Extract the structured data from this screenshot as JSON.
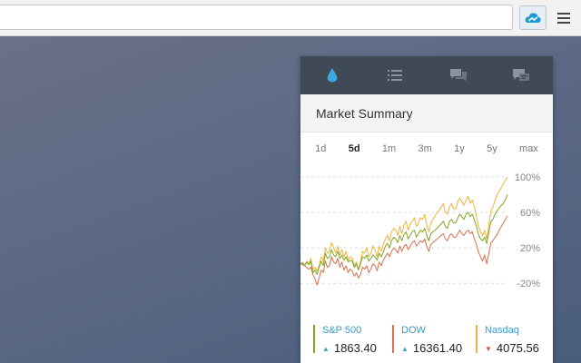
{
  "browser": {
    "url_value": "",
    "extension_icon": "cloud-sync-icon",
    "menu_icon": "hamburger-menu-icon"
  },
  "popup": {
    "tabs": [
      {
        "icon": "drop-icon",
        "active": true
      },
      {
        "icon": "list-icon",
        "active": false
      },
      {
        "icon": "chat-bubbles-icon",
        "active": false
      },
      {
        "icon": "chat-window-icon",
        "active": false
      }
    ],
    "section_title": "Market Summary",
    "ranges": [
      "1d",
      "5d",
      "1m",
      "3m",
      "1y",
      "5y",
      "max"
    ],
    "active_range": "5d",
    "colors": {
      "tab_bg": "#404a56",
      "active_tab_icon": "#3ba9e0",
      "inactive_tab_icon": "#8a939e",
      "sp500": "#7ea51f",
      "dow": "#d9704b",
      "nasdaq": "#f0b23e",
      "up": "#3aa8b3",
      "down": "#d9563a"
    }
  },
  "chart_data": {
    "type": "line",
    "x": [
      0,
      1,
      2,
      3,
      4,
      5,
      6,
      7,
      8,
      9,
      10,
      11,
      12,
      13,
      14,
      15,
      16,
      17,
      18,
      19,
      20,
      21,
      22,
      23,
      24,
      25,
      26,
      27,
      28,
      29,
      30,
      31,
      32,
      33,
      34,
      35,
      36,
      37,
      38,
      39,
      40,
      41,
      42,
      43,
      44,
      45,
      46,
      47,
      48,
      49,
      50,
      51,
      52,
      53,
      54,
      55,
      56,
      57,
      58,
      59,
      60,
      61,
      62,
      63,
      64,
      65,
      66,
      67,
      68,
      69,
      70,
      71,
      72,
      73,
      74,
      75,
      76,
      77,
      78,
      79,
      80,
      81,
      82,
      83,
      84,
      85,
      86,
      87,
      88,
      89,
      90,
      91,
      92,
      93,
      94,
      95,
      96,
      97,
      98,
      99,
      100
    ],
    "yticks": [
      "100%",
      "60%",
      "20%",
      "-20%"
    ],
    "ylim": [
      -30,
      105
    ],
    "series": [
      {
        "name": "S&P 500",
        "values": [
          2,
          3,
          0,
          4,
          1,
          5,
          -8,
          -5,
          -10,
          -2,
          5,
          0,
          14,
          8,
          10,
          18,
          12,
          10,
          16,
          8,
          12,
          6,
          10,
          4,
          6,
          5,
          -2,
          2,
          -5,
          2,
          10,
          8,
          12,
          5,
          8,
          12,
          10,
          6,
          14,
          10,
          15,
          22,
          25,
          20,
          28,
          32,
          30,
          26,
          34,
          28,
          35,
          38,
          30,
          34,
          38,
          40,
          32,
          36,
          40,
          38,
          42,
          34,
          28,
          36,
          38,
          40,
          42,
          45,
          47,
          50,
          44,
          42,
          50,
          52,
          48,
          48,
          54,
          58,
          55,
          52,
          58,
          60,
          55,
          58,
          52,
          44,
          35,
          30,
          28,
          32,
          25,
          38,
          50,
          52,
          58,
          62,
          65,
          68,
          70,
          74,
          80
        ],
        "values_unit": "percent"
      },
      {
        "name": "DOW",
        "values": [
          2,
          1,
          0,
          -2,
          -4,
          -2,
          -10,
          -15,
          -22,
          -14,
          -5,
          -8,
          5,
          -2,
          0,
          10,
          4,
          2,
          8,
          -2,
          4,
          -5,
          0,
          -8,
          -4,
          -6,
          -12,
          -8,
          -14,
          -10,
          -2,
          -4,
          0,
          -8,
          -4,
          2,
          0,
          -6,
          4,
          0,
          6,
          10,
          14,
          10,
          16,
          20,
          18,
          14,
          22,
          16,
          22,
          24,
          18,
          22,
          26,
          28,
          22,
          25,
          28,
          26,
          30,
          22,
          16,
          24,
          26,
          28,
          30,
          32,
          34,
          36,
          30,
          28,
          34,
          36,
          32,
          32,
          36,
          40,
          36,
          34,
          38,
          40,
          36,
          38,
          30,
          24,
          15,
          10,
          5,
          12,
          2,
          14,
          26,
          28,
          32,
          35,
          40,
          44,
          48,
          52,
          56
        ],
        "values_unit": "percent"
      },
      {
        "name": "Nasdaq",
        "values": [
          2,
          4,
          0,
          5,
          2,
          8,
          -4,
          -2,
          -6,
          0,
          10,
          5,
          20,
          14,
          16,
          26,
          20,
          14,
          22,
          12,
          18,
          10,
          16,
          6,
          10,
          8,
          0,
          4,
          -4,
          4,
          16,
          14,
          20,
          10,
          14,
          22,
          18,
          10,
          22,
          16,
          24,
          30,
          34,
          28,
          38,
          42,
          40,
          34,
          44,
          36,
          46,
          50,
          40,
          46,
          50,
          54,
          44,
          48,
          54,
          52,
          58,
          46,
          38,
          48,
          52,
          56,
          60,
          62,
          66,
          70,
          60,
          58,
          66,
          70,
          64,
          64,
          72,
          76,
          72,
          68,
          74,
          78,
          70,
          74,
          66,
          56,
          44,
          38,
          34,
          40,
          30,
          46,
          62,
          66,
          74,
          80,
          84,
          88,
          92,
          96,
          100
        ],
        "values_unit": "percent"
      }
    ]
  },
  "legend": [
    {
      "name": "S&P 500",
      "value": "1863.40",
      "direction": "up"
    },
    {
      "name": "DOW",
      "value": "16361.40",
      "direction": "up"
    },
    {
      "name": "Nasdaq",
      "value": "4075.56",
      "direction": "down"
    }
  ]
}
